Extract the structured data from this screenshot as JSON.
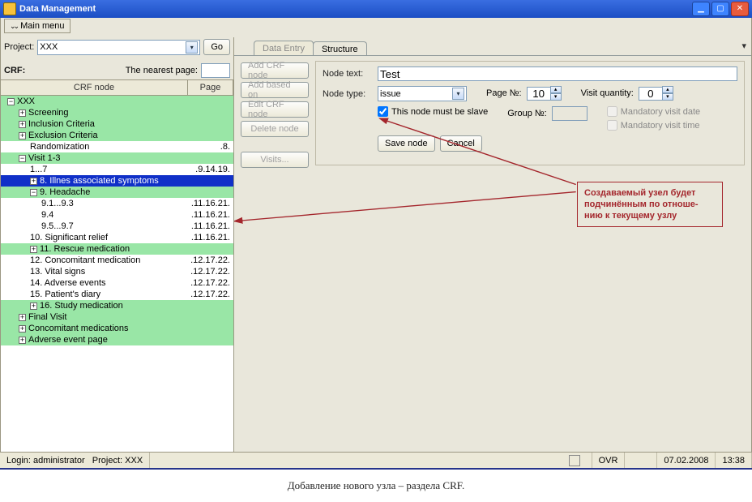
{
  "window": {
    "title": "Data Management",
    "main_menu": "Main menu"
  },
  "left": {
    "project_label": "Project:",
    "project_value": "XXX",
    "go": "Go",
    "crf_label": "CRF:",
    "nearest_label": "The nearest page:",
    "col_node": "CRF node",
    "col_page": "Page"
  },
  "tree": [
    {
      "lvl": 0,
      "cls": "green",
      "exp": "−",
      "label": "XXX",
      "page": ""
    },
    {
      "lvl": 1,
      "cls": "green",
      "exp": "+",
      "label": "Screening",
      "page": ""
    },
    {
      "lvl": 1,
      "cls": "green",
      "exp": "+",
      "label": "Inclusion Criteria",
      "page": ""
    },
    {
      "lvl": 1,
      "cls": "green",
      "exp": "+",
      "label": "Exclusion Criteria",
      "page": ""
    },
    {
      "lvl": 2,
      "cls": "white",
      "exp": "",
      "label": "Randomization",
      "page": ".8."
    },
    {
      "lvl": 1,
      "cls": "green",
      "exp": "−",
      "label": "Visit 1-3",
      "page": ""
    },
    {
      "lvl": 2,
      "cls": "white",
      "exp": "",
      "label": "1...7",
      "page": ".9.14.19."
    },
    {
      "lvl": 2,
      "cls": "blue",
      "exp": "+",
      "label": "8. Illnes associated symptoms",
      "page": ""
    },
    {
      "lvl": 2,
      "cls": "green",
      "exp": "−",
      "label": "9. Headache",
      "page": ""
    },
    {
      "lvl": 3,
      "cls": "white",
      "exp": "",
      "label": "9.1...9.3",
      "page": ".11.16.21."
    },
    {
      "lvl": 3,
      "cls": "white",
      "exp": "",
      "label": "9.4",
      "page": ".11.16.21."
    },
    {
      "lvl": 3,
      "cls": "white",
      "exp": "",
      "label": "9.5...9.7",
      "page": ".11.16.21."
    },
    {
      "lvl": 2,
      "cls": "white",
      "exp": "",
      "label": "10. Significant relief",
      "page": ".11.16.21."
    },
    {
      "lvl": 2,
      "cls": "green",
      "exp": "+",
      "label": "11. Rescue medication",
      "page": ""
    },
    {
      "lvl": 2,
      "cls": "white",
      "exp": "",
      "label": "12. Concomitant medication",
      "page": ".12.17.22."
    },
    {
      "lvl": 2,
      "cls": "white",
      "exp": "",
      "label": "13. Vital signs",
      "page": ".12.17.22."
    },
    {
      "lvl": 2,
      "cls": "white",
      "exp": "",
      "label": "14. Adverse events",
      "page": ".12.17.22."
    },
    {
      "lvl": 2,
      "cls": "white",
      "exp": "",
      "label": "15. Patient's diary",
      "page": ".12.17.22."
    },
    {
      "lvl": 2,
      "cls": "green",
      "exp": "+",
      "label": "16. Study medication",
      "page": ""
    },
    {
      "lvl": 1,
      "cls": "green",
      "exp": "+",
      "label": "Final Visit",
      "page": ""
    },
    {
      "lvl": 1,
      "cls": "green",
      "exp": "+",
      "label": "Concomitant medications",
      "page": ""
    },
    {
      "lvl": 1,
      "cls": "green",
      "exp": "+",
      "label": "Adverse event page",
      "page": ""
    }
  ],
  "tabs": {
    "data_entry": "Data Entry",
    "structure": "Structure"
  },
  "btncol": {
    "add_crf": "Add CRF node",
    "add_based": "Add based on",
    "edit_crf": "Edit CRF node",
    "delete": "Delete node",
    "visits": "Visits..."
  },
  "form": {
    "node_text_label": "Node text:",
    "node_text_value": "Test",
    "node_type_label": "Node type:",
    "node_type_value": "issue",
    "slave_label": "This node must be slave",
    "page_n_label": "Page №:",
    "page_n_value": "10",
    "group_n_label": "Group №:",
    "visit_qty_label": "Visit quantity:",
    "visit_qty_value": "0",
    "mand_date": "Mandatory visit date",
    "mand_time": "Mandatory visit time",
    "save": "Save node",
    "cancel": "Cancel"
  },
  "annotation": {
    "l1": "Создаваемый узел будет",
    "l2": "подчинённым по отноше-",
    "l3": "нию к текущему узлу"
  },
  "status": {
    "login_label": "Login:",
    "login_value": "administrator",
    "project_label": "Project:",
    "project_value": "XXX",
    "ovr": "OVR",
    "date": "07.02.2008",
    "time": "13:38"
  },
  "caption": "Добавление   нового узла – раздела CRF."
}
